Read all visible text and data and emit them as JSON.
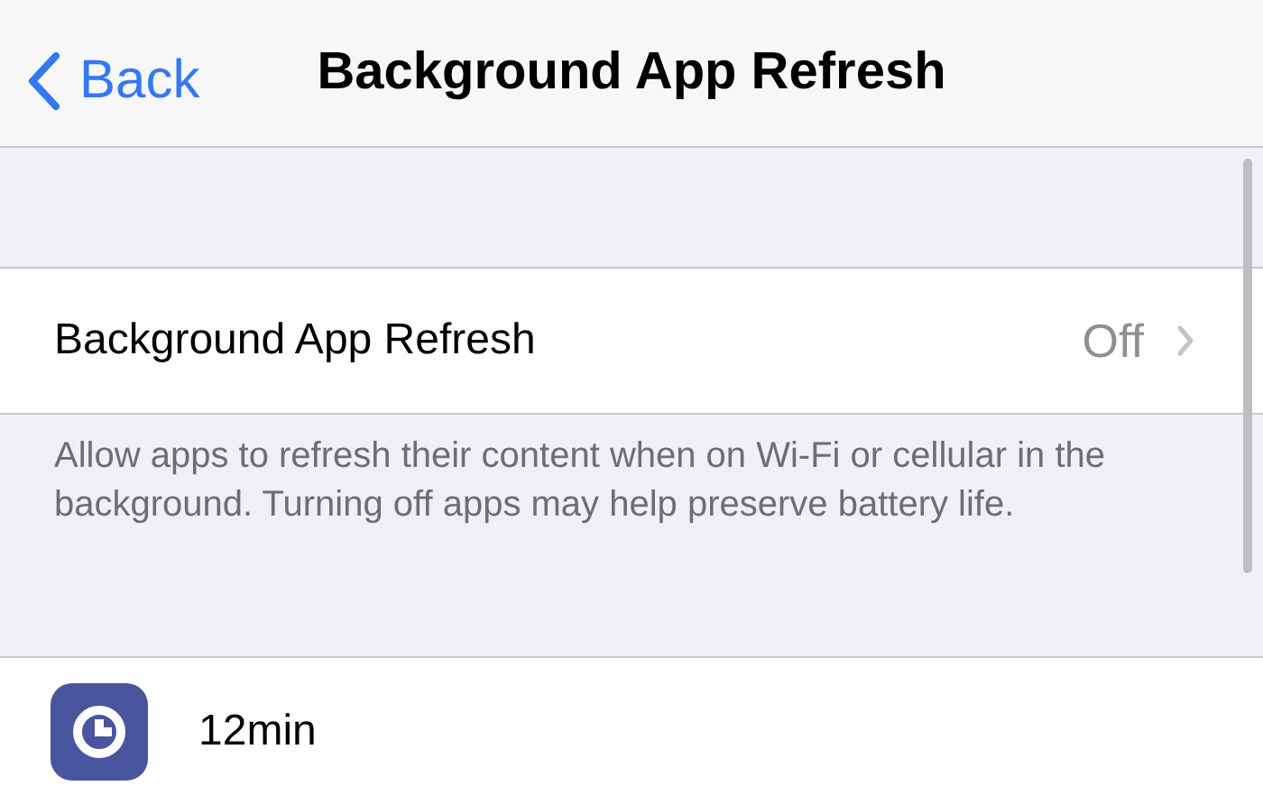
{
  "nav": {
    "back": "Back",
    "title": "Background App Refresh"
  },
  "setting": {
    "label": "Background App Refresh",
    "value": "Off"
  },
  "footer": "Allow apps to refresh their content when on Wi-Fi or cellular in the background. Turning off apps may help preserve battery life.",
  "apps": [
    {
      "name": "12min"
    }
  ]
}
